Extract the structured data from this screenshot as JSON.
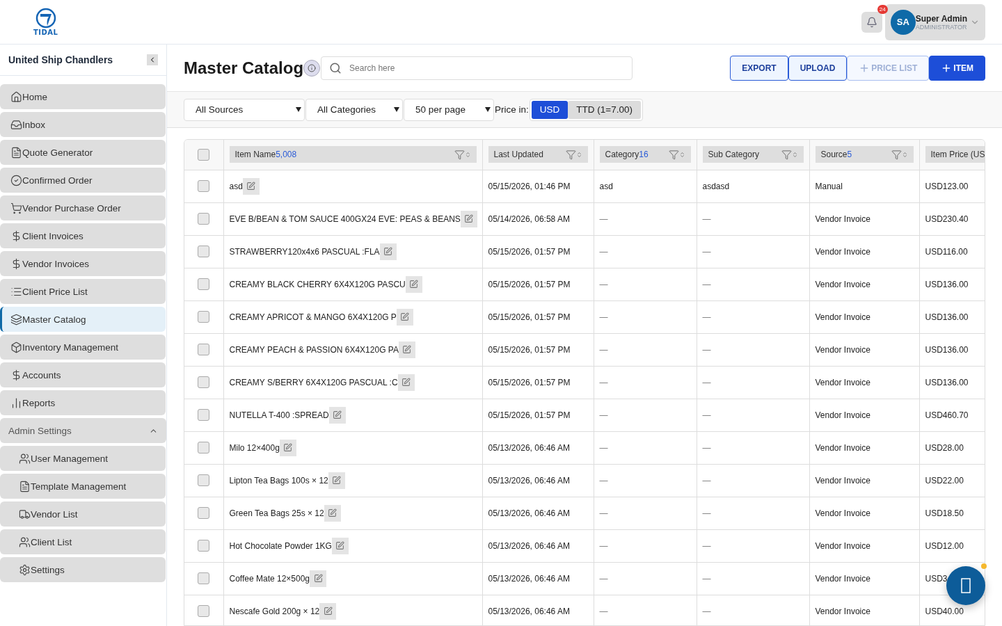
{
  "logo": {
    "text": "TIDAL"
  },
  "notifications": {
    "count": "24"
  },
  "user": {
    "initials": "SA",
    "name": "Super Admin",
    "role": "ADMINISTRATOR"
  },
  "sidebar": {
    "company": "United Ship Chandlers",
    "items": [
      {
        "label": "Home",
        "selected": false
      },
      {
        "label": "Inbox",
        "selected": false
      },
      {
        "label": "Quote Generator",
        "selected": false
      },
      {
        "label": "Confirmed Order",
        "selected": false
      },
      {
        "label": "Vendor Purchase Order",
        "selected": false
      },
      {
        "label": "Client Invoices",
        "selected": false
      },
      {
        "label": "Vendor Invoices",
        "selected": false
      },
      {
        "label": "Client Price List",
        "selected": false
      },
      {
        "label": "Master Catalog",
        "selected": true
      },
      {
        "label": "Inventory Management",
        "selected": false
      },
      {
        "label": "Accounts",
        "selected": false
      },
      {
        "label": "Reports",
        "selected": false
      }
    ],
    "group": {
      "label": "Admin Settings",
      "expanded": true,
      "children": [
        {
          "label": "User Management",
          "selected": false
        },
        {
          "label": "Template Management",
          "selected": false
        },
        {
          "label": "Vendor List",
          "selected": false
        },
        {
          "label": "Client List",
          "selected": false
        },
        {
          "label": "Settings",
          "selected": false
        }
      ]
    }
  },
  "page": {
    "title": "Master Catalog",
    "search": {
      "placeholder": "Search here"
    },
    "buttons": [
      {
        "label": "EXPORT",
        "kind": "outline",
        "disabled": false
      },
      {
        "label": "UPLOAD",
        "kind": "outline",
        "disabled": false
      },
      {
        "label": "PRICE LIST",
        "kind": "add",
        "disabled": true
      },
      {
        "label": "ITEM",
        "kind": "add",
        "disabled": false
      }
    ]
  },
  "filters": {
    "selects": [
      "All Sources",
      "All Categories",
      "50 per page"
    ],
    "price_label": "Price in:",
    "currencies": [
      {
        "label": "USD",
        "selected": true
      },
      {
        "label": "TTD (1=7.00)",
        "selected": false
      }
    ]
  },
  "table": {
    "select_all": {
      "checked": false
    },
    "columns": [
      {
        "label": "Item Name",
        "count": "5,008"
      },
      {
        "label": "Last Updated"
      },
      {
        "label": "Category",
        "count": "16"
      },
      {
        "label": "Sub Category"
      },
      {
        "label": "Source",
        "count": "5"
      },
      {
        "label": "Item Price (US"
      }
    ],
    "rows": [
      {
        "checked": false,
        "name": "asd",
        "updated": "05/15/2026, 01:46 PM",
        "category": "asd",
        "sub_category": "asdasd",
        "source": "Manual",
        "price": "USD123.00"
      },
      {
        "checked": false,
        "name": "EVE B/BEAN & TOM SAUCE 400GX24 EVE: PEAS & BEANS",
        "updated": "05/14/2026, 06:58 AM",
        "category": "—",
        "sub_category": "—",
        "source": "Vendor Invoice",
        "price": "USD230.40"
      },
      {
        "checked": false,
        "name": "STRAWBERRY120x4x6 PASCUAL :FLA",
        "updated": "05/15/2026, 01:57 PM",
        "category": "—",
        "sub_category": "—",
        "source": "Vendor Invoice",
        "price": "USD116.00"
      },
      {
        "checked": false,
        "name": "CREAMY BLACK CHERRY 6X4X120G PASCU",
        "updated": "05/15/2026, 01:57 PM",
        "category": "—",
        "sub_category": "—",
        "source": "Vendor Invoice",
        "price": "USD136.00"
      },
      {
        "checked": false,
        "name": "CREAMY APRICOT & MANGO 6X4X120G P",
        "updated": "05/15/2026, 01:57 PM",
        "category": "—",
        "sub_category": "—",
        "source": "Vendor Invoice",
        "price": "USD136.00"
      },
      {
        "checked": false,
        "name": "CREAMY PEACH & PASSION 6X4X120G PA",
        "updated": "05/15/2026, 01:57 PM",
        "category": "—",
        "sub_category": "—",
        "source": "Vendor Invoice",
        "price": "USD136.00"
      },
      {
        "checked": false,
        "name": "CREAMY S/BERRY 6X4X120G PASCUAL :C",
        "updated": "05/15/2026, 01:57 PM",
        "category": "—",
        "sub_category": "—",
        "source": "Vendor Invoice",
        "price": "USD136.00"
      },
      {
        "checked": false,
        "name": "NUTELLA T-400 :SPREAD",
        "updated": "05/15/2026, 01:57 PM",
        "category": "—",
        "sub_category": "—",
        "source": "Vendor Invoice",
        "price": "USD460.70"
      },
      {
        "checked": false,
        "name": "Milo 12×400g",
        "updated": "05/13/2026, 06:46 AM",
        "category": "—",
        "sub_category": "—",
        "source": "Vendor Invoice",
        "price": "USD28.00"
      },
      {
        "checked": false,
        "name": "Lipton Tea Bags 100s × 12",
        "updated": "05/13/2026, 06:46 AM",
        "category": "—",
        "sub_category": "—",
        "source": "Vendor Invoice",
        "price": "USD22.00"
      },
      {
        "checked": false,
        "name": "Green Tea Bags 25s × 12",
        "updated": "05/13/2026, 06:46 AM",
        "category": "—",
        "sub_category": "—",
        "source": "Vendor Invoice",
        "price": "USD18.50"
      },
      {
        "checked": false,
        "name": "Hot Chocolate Powder 1KG",
        "updated": "05/13/2026, 06:46 AM",
        "category": "—",
        "sub_category": "—",
        "source": "Vendor Invoice",
        "price": "USD12.00"
      },
      {
        "checked": false,
        "name": "Coffee Mate 12×500g",
        "updated": "05/13/2026, 06:46 AM",
        "category": "—",
        "sub_category": "—",
        "source": "Vendor Invoice",
        "price": "USD3"
      },
      {
        "checked": false,
        "name": "Nescafe Gold 200g × 12",
        "updated": "05/13/2026, 06:46 AM",
        "category": "—",
        "sub_category": "—",
        "source": "Vendor Invoice",
        "price": "USD40.00"
      }
    ]
  },
  "chat": {
    "unread": true
  }
}
